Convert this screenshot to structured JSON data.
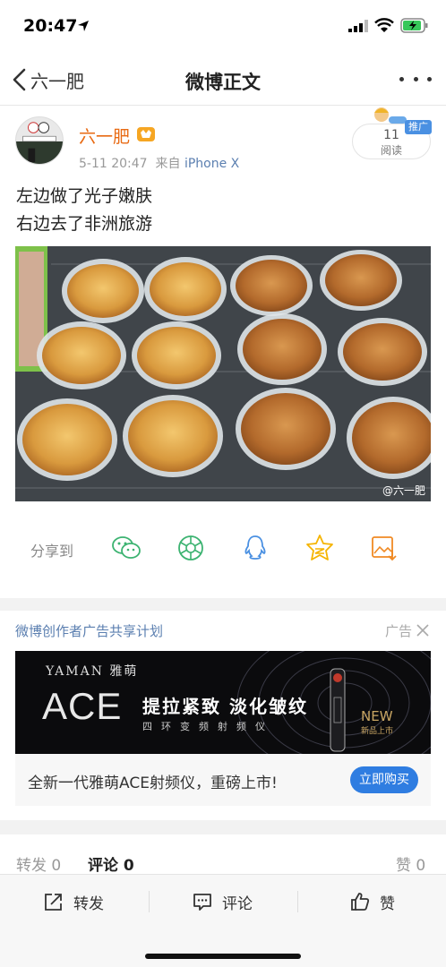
{
  "status_bar": {
    "time": "20:47"
  },
  "nav": {
    "back_label": "六一肥",
    "title": "微博正文"
  },
  "post": {
    "author": "六一肥",
    "time": "5-11 20:47",
    "source_prefix": "来自",
    "source": "iPhone X",
    "read_count": "11",
    "read_label": "阅读",
    "promo_tag": "推广",
    "text_line1": "左边做了光子嫩肤",
    "text_line2": "右边去了非洲旅游",
    "watermark": "@六一肥"
  },
  "share": {
    "label": "分享到",
    "targets": [
      "wechat-icon",
      "moments-icon",
      "qq-icon",
      "qzone-icon",
      "save-image-icon"
    ]
  },
  "ad": {
    "title": "微博创作者广告共享计划",
    "label": "广告",
    "brand": "YAMAN 雅萌",
    "product": "ACE",
    "headline": "提拉紧致 淡化皱纹",
    "subheadline": "四环变频射频仪",
    "new_label": "NEW",
    "new_sub": "新品上市",
    "description": "全新一代雅萌ACE射频仪，重磅上市!",
    "cta": "立即购买"
  },
  "stats": {
    "repost": "转发 0",
    "comment": "评论 0",
    "like": "赞 0"
  },
  "actions": {
    "repost": "转发",
    "comment": "评论",
    "like": "赞"
  },
  "colors": {
    "accent": "#e86a13",
    "link": "#5b7fb0",
    "button": "#2f7de1"
  }
}
